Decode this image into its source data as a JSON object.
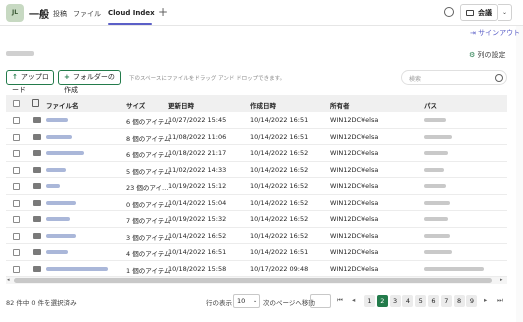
{
  "header": {
    "avatar_initials": "JL",
    "channel": "一般",
    "tabs": [
      "投稿",
      "ファイル",
      "Cloud Index"
    ],
    "meet_label": "会議"
  },
  "signout": "サインアウト",
  "column_settings": "列の設定",
  "toolbar": {
    "upload": "アップロード",
    "new_folder": "フォルダーの作成",
    "drop_hint": "下のスペースにファイルをドラッグ アンド ドロップできます。",
    "search_placeholder": "検索"
  },
  "table": {
    "headers": [
      "ファイル名",
      "サイズ",
      "更新日時",
      "作成日時",
      "所有者",
      "パス"
    ],
    "rows": [
      {
        "size": "6 個のアイテム",
        "modified": "10/27/2022 15:45",
        "created": "10/14/2022 16:51",
        "owner": "WIN12DC¥elsa"
      },
      {
        "size": "8 個のアイテム",
        "modified": "11/08/2022 11:06",
        "created": "10/14/2022 16:51",
        "owner": "WIN12DC¥elsa"
      },
      {
        "size": "6 個のアイテム",
        "modified": "10/18/2022 21:17",
        "created": "10/14/2022 16:52",
        "owner": "WIN12DC¥elsa"
      },
      {
        "size": "5 個のアイテム",
        "modified": "11/02/2022 14:33",
        "created": "10/14/2022 16:52",
        "owner": "WIN12DC¥elsa"
      },
      {
        "size": "23 個のアイ…",
        "modified": "10/19/2022 15:12",
        "created": "10/14/2022 16:52",
        "owner": "WIN12DC¥elsa"
      },
      {
        "size": "0 個のアイテム",
        "modified": "10/14/2022 15:04",
        "created": "10/14/2022 16:52",
        "owner": "WIN12DC¥elsa"
      },
      {
        "size": "7 個のアイテム",
        "modified": "10/19/2022 15:32",
        "created": "10/14/2022 16:52",
        "owner": "WIN12DC¥elsa"
      },
      {
        "size": "3 個のアイテム",
        "modified": "10/14/2022 16:52",
        "created": "10/14/2022 16:52",
        "owner": "WIN12DC¥elsa"
      },
      {
        "size": "4 個のアイテム",
        "modified": "10/14/2022 16:51",
        "created": "10/14/2022 16:51",
        "owner": "WIN12DC¥elsa"
      },
      {
        "size": "1 個のアイテム",
        "modified": "10/18/2022 15:58",
        "created": "10/17/2022 09:48",
        "owner": "WIN12DC¥elsa"
      }
    ]
  },
  "footer": {
    "status": "82 件中 0 件を選択済み",
    "rows_label": "行の表示",
    "rows_value": "10",
    "goto_label": "次のページへ移動",
    "pages": [
      "1",
      "2",
      "3",
      "4",
      "5",
      "6",
      "7",
      "8",
      "9"
    ],
    "current_page": "2"
  }
}
